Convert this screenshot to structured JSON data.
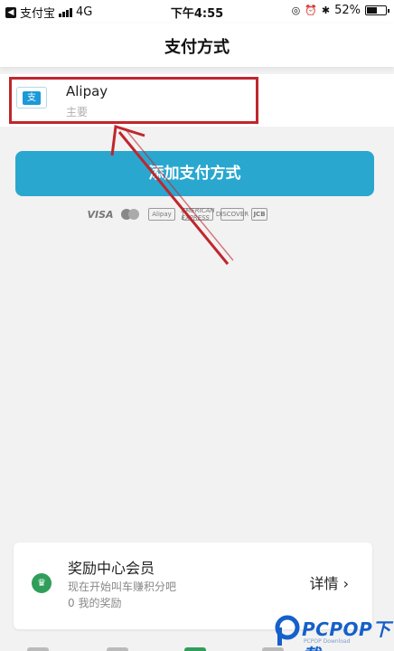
{
  "status_bar": {
    "carrier": "支付宝",
    "network": "4G",
    "time": "下午4:55",
    "battery": "52%"
  },
  "nav": {
    "title": "支付方式"
  },
  "payment_method": {
    "name": "Alipay",
    "subtitle": "主要",
    "logo_glyph": "支"
  },
  "add_button": {
    "label": "添加支付方式"
  },
  "card_logos": {
    "visa": "VISA",
    "alipay": "Alipay",
    "amex": "AMERICAN EXPRESS",
    "discover": "DISCOVER",
    "jcb": "JCB"
  },
  "rewards": {
    "title": "奖励中心会员",
    "line1": "现在开始叫车赚积分吧",
    "line2": "0 我的奖励",
    "details": "详情 ›",
    "crown_glyph": "♛"
  },
  "watermark": {
    "text": "PCPOP下载",
    "sub": "PCPOP Download"
  },
  "colors": {
    "accent": "#2aa7cf",
    "highlight": "#c0262c",
    "crown": "#2f9e5a",
    "watermark": "#1560c9"
  }
}
